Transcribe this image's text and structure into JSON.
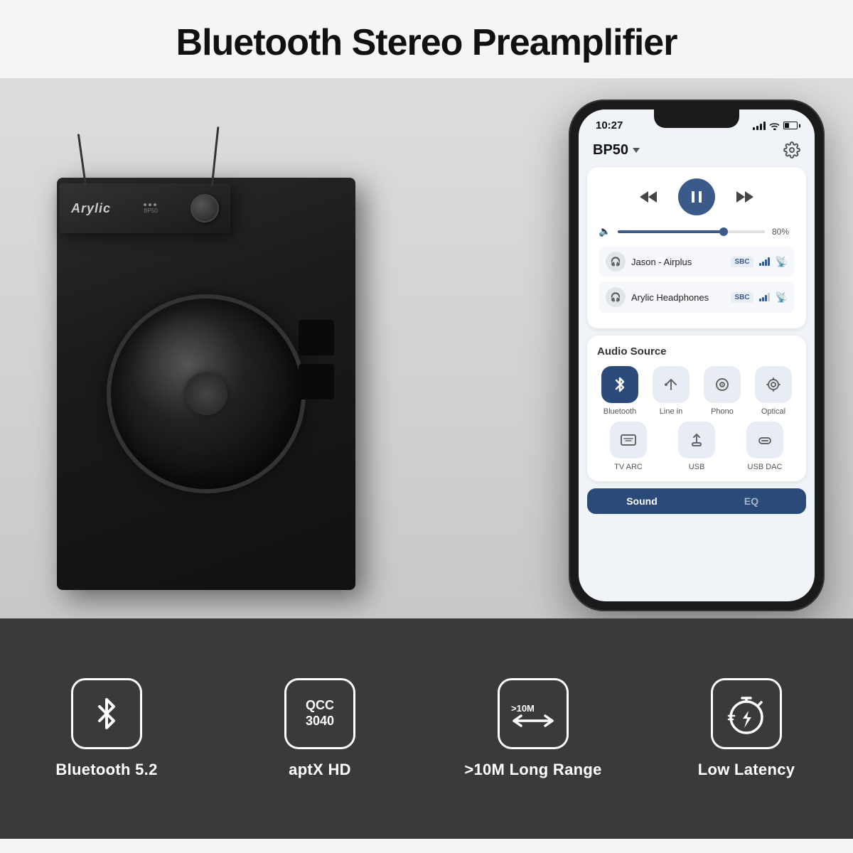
{
  "page": {
    "title": "Bluetooth Stereo Preamplifier"
  },
  "phone": {
    "status": {
      "time": "10:27",
      "battery": "37"
    },
    "header": {
      "device": "BP50",
      "settings_label": "⚙"
    },
    "player": {
      "volume_pct": "80%",
      "volume_fill_width": "72%",
      "devices": [
        {
          "name": "Jason - Airplus",
          "codec": "SBC"
        },
        {
          "name": "Arylic Headphones",
          "codec": "SBC"
        }
      ]
    },
    "audio_source": {
      "title": "Audio Source",
      "sources_row1": [
        {
          "label": "Bluetooth",
          "active": true
        },
        {
          "label": "Line in",
          "active": false
        },
        {
          "label": "Phono",
          "active": false
        },
        {
          "label": "Optical",
          "active": false
        }
      ],
      "sources_row2": [
        {
          "label": "TV ARC",
          "active": false
        },
        {
          "label": "USB",
          "active": false
        },
        {
          "label": "USB DAC",
          "active": false
        }
      ]
    },
    "tabs": [
      {
        "label": "Sound",
        "active": true
      },
      {
        "label": "EQ",
        "active": false
      }
    ]
  },
  "features": [
    {
      "id": "bluetooth",
      "label": "Bluetooth 5.2",
      "icon_text": "BT"
    },
    {
      "id": "aptx",
      "label": "aptX HD",
      "icon_text": "QCC\n3040"
    },
    {
      "id": "range",
      "label": ">10M Long Range",
      "icon_text": ">10M"
    },
    {
      "id": "latency",
      "label": "Low Latency",
      "icon_text": "⚡"
    }
  ],
  "amp": {
    "brand": "Arylic",
    "model": "BP50"
  }
}
